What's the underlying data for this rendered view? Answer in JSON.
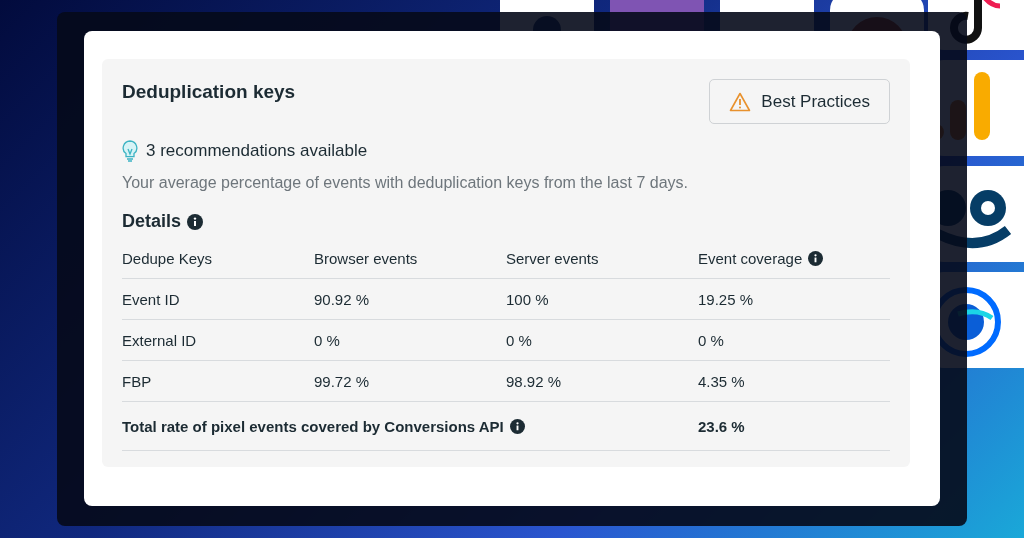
{
  "panel": {
    "title": "Deduplication keys",
    "button": "Best Practices",
    "recommendations": "3 recommendations available",
    "description": "Your average percentage of events with deduplication keys from the last 7 days.",
    "details_heading": "Details"
  },
  "table": {
    "columns": [
      "Dedupe Keys",
      "Browser events",
      "Server events",
      "Event coverage"
    ],
    "rows": [
      [
        "Event ID",
        "90.92 %",
        "100 %",
        "19.25 %"
      ],
      [
        "External ID",
        "0 %",
        "0 %",
        "0 %"
      ],
      [
        "FBP",
        "99.72 %",
        "98.92 %",
        "4.35 %"
      ]
    ],
    "total": {
      "label": "Total rate of pixel events covered by Conversions API",
      "value": "23.6 %"
    }
  }
}
